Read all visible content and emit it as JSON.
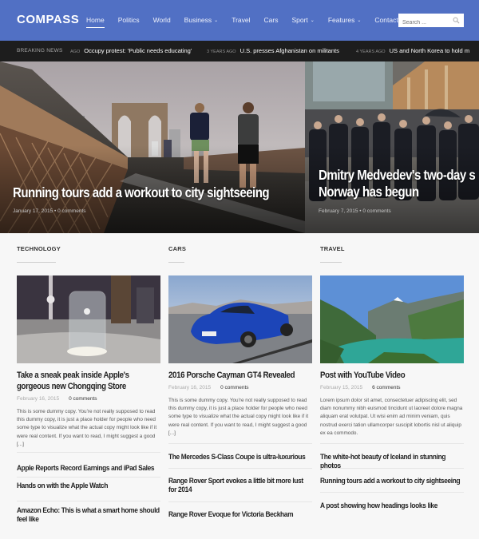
{
  "header": {
    "logo": "COMPASS",
    "nav": [
      {
        "label": "Home",
        "active": true,
        "dropdown": false
      },
      {
        "label": "Politics",
        "active": false,
        "dropdown": false
      },
      {
        "label": "World",
        "active": false,
        "dropdown": false
      },
      {
        "label": "Business",
        "active": false,
        "dropdown": true
      },
      {
        "label": "Travel",
        "active": false,
        "dropdown": false
      },
      {
        "label": "Cars",
        "active": false,
        "dropdown": false
      },
      {
        "label": "Sport",
        "active": false,
        "dropdown": true
      },
      {
        "label": "Features",
        "active": false,
        "dropdown": true
      },
      {
        "label": "Contact",
        "active": false,
        "dropdown": false
      }
    ],
    "search_placeholder": "Search ...",
    "search_value": "",
    "caret_glyph": "⌄",
    "brand_color": "#5170c4"
  },
  "ticker": {
    "label": "BREAKING NEWS",
    "items": [
      {
        "ago": "AGO",
        "text": "Occupy protest: 'Public needs educating'"
      },
      {
        "ago": "3 YEARS AGO",
        "text": "U.S. presses Afghanistan on militants"
      },
      {
        "ago": "4 YEARS AGO",
        "text": "US and North Korea to hold m"
      }
    ]
  },
  "hero": [
    {
      "title": "Running tours add a workout to city sightseeing",
      "meta": "January 17, 2015  •  0 comments"
    },
    {
      "title_lines": [
        "Dmitry Medvedev's two-day s",
        "Norway has begun"
      ],
      "meta": "February 7, 2015  •  0 comments"
    }
  ],
  "columns": [
    {
      "section": "TECHNOLOGY",
      "featured": {
        "title": "Take a sneak peak inside Apple's gorgeous new Chongqing Store",
        "date": "February 16, 2015",
        "comments": "0 comments",
        "excerpt": "This is some dummy copy. You're not really supposed to read this dummy copy, it is just a place holder for people who need some type to visualize what the actual copy might look like if it were real content. If you want to read, I might suggest a good [...]"
      },
      "list": [
        "Apple Reports Record Earnings and iPad Sales",
        "Hands on with the Apple Watch",
        "Amazon Echo: This is what a smart home should feel like"
      ]
    },
    {
      "section": "CARS",
      "featured": {
        "title": "2016 Porsche Cayman GT4 Revealed",
        "date": "February 16, 2015",
        "comments": "0 comments",
        "excerpt": "This is some dummy copy. You're not really supposed to read this dummy copy, it is just a place holder for people who need some type to visualize what the actual copy might look like if it were real content. If you want to read, I might suggest a good [...]"
      },
      "list": [
        "The Mercedes S-Class Coupe is ultra-luxurious",
        "Range Rover Sport evokes a little bit more lust for 2014",
        "Range Rover Evoque for Victoria Beckham"
      ]
    },
    {
      "section": "TRAVEL",
      "featured": {
        "title": "Post with YouTube Video",
        "date": "February 15, 2015",
        "comments": "6 comments",
        "excerpt": "Lorem ipsum dolor sit amet, consectetuer adipiscing elit, sed diam nonummy nibh euismod tincidunt ut laoreet dolore magna aliquam erat volutpat. Ut wisi enim ad minim veniam, quis nostrud exerci tation ullamcorper suscipit lobortis nisl ut aliquip ex ea commodo."
      },
      "list": [
        "The white-hot beauty of Iceland in stunning photos",
        "Running tours add a workout to city sightseeing",
        "A post showing how headings looks like"
      ]
    }
  ]
}
